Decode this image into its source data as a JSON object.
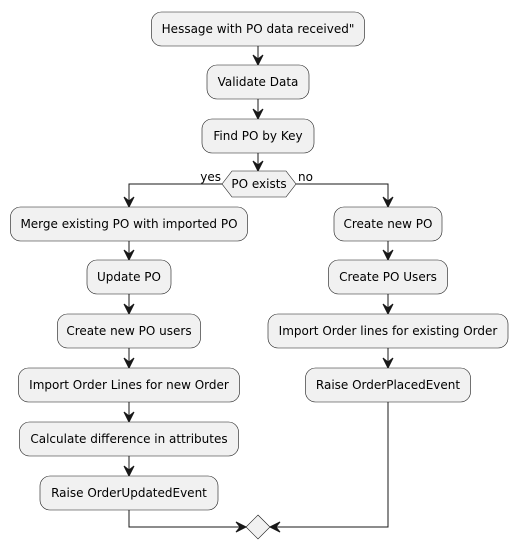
{
  "diagram": {
    "type": "activity",
    "start_steps": [
      "Hessage with PO data received\"",
      "Validate Data",
      "Find PO by Key"
    ],
    "decision": {
      "condition": "PO exists",
      "yes_label": "yes",
      "no_label": "no"
    },
    "yes_branch": [
      "Merge existing PO with imported PO",
      "Update PO",
      "Create new PO users",
      "Import Order Lines for new Order",
      "Calculate difference in attributes",
      "Raise OrderUpdatedEvent"
    ],
    "no_branch": [
      "Create new PO",
      "Create PO Users",
      "Import Order lines for existing Order",
      "Raise OrderPlacedEvent"
    ],
    "colors": {
      "node_fill": "#F1F1F1",
      "line": "#181818"
    }
  }
}
